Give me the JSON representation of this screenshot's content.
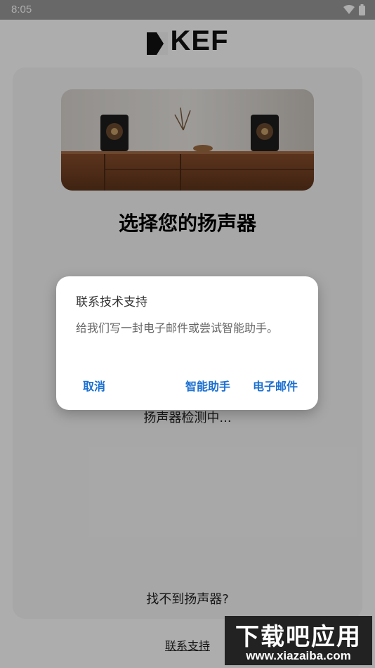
{
  "status_bar": {
    "time": "8:05",
    "icons": [
      "wifi-icon",
      "battery-icon"
    ]
  },
  "brand": {
    "name": "KEF"
  },
  "main": {
    "title": "选择您的扬声器",
    "detecting_text": "扬声器检测中...",
    "not_found_text": "找不到扬声器?",
    "contact_link": "联系支持"
  },
  "dialog": {
    "title": "联系技术支持",
    "message": "给我们写一封电子邮件或尝试智能助手。",
    "buttons": {
      "cancel": "取消",
      "assistant": "智能助手",
      "email": "电子邮件"
    }
  },
  "watermark": {
    "title": "下载吧应用",
    "url": "www.xiazaiba.com"
  },
  "colors": {
    "accent": "#1a6fd1",
    "scrim": "rgba(0,0,0,0.32)"
  }
}
